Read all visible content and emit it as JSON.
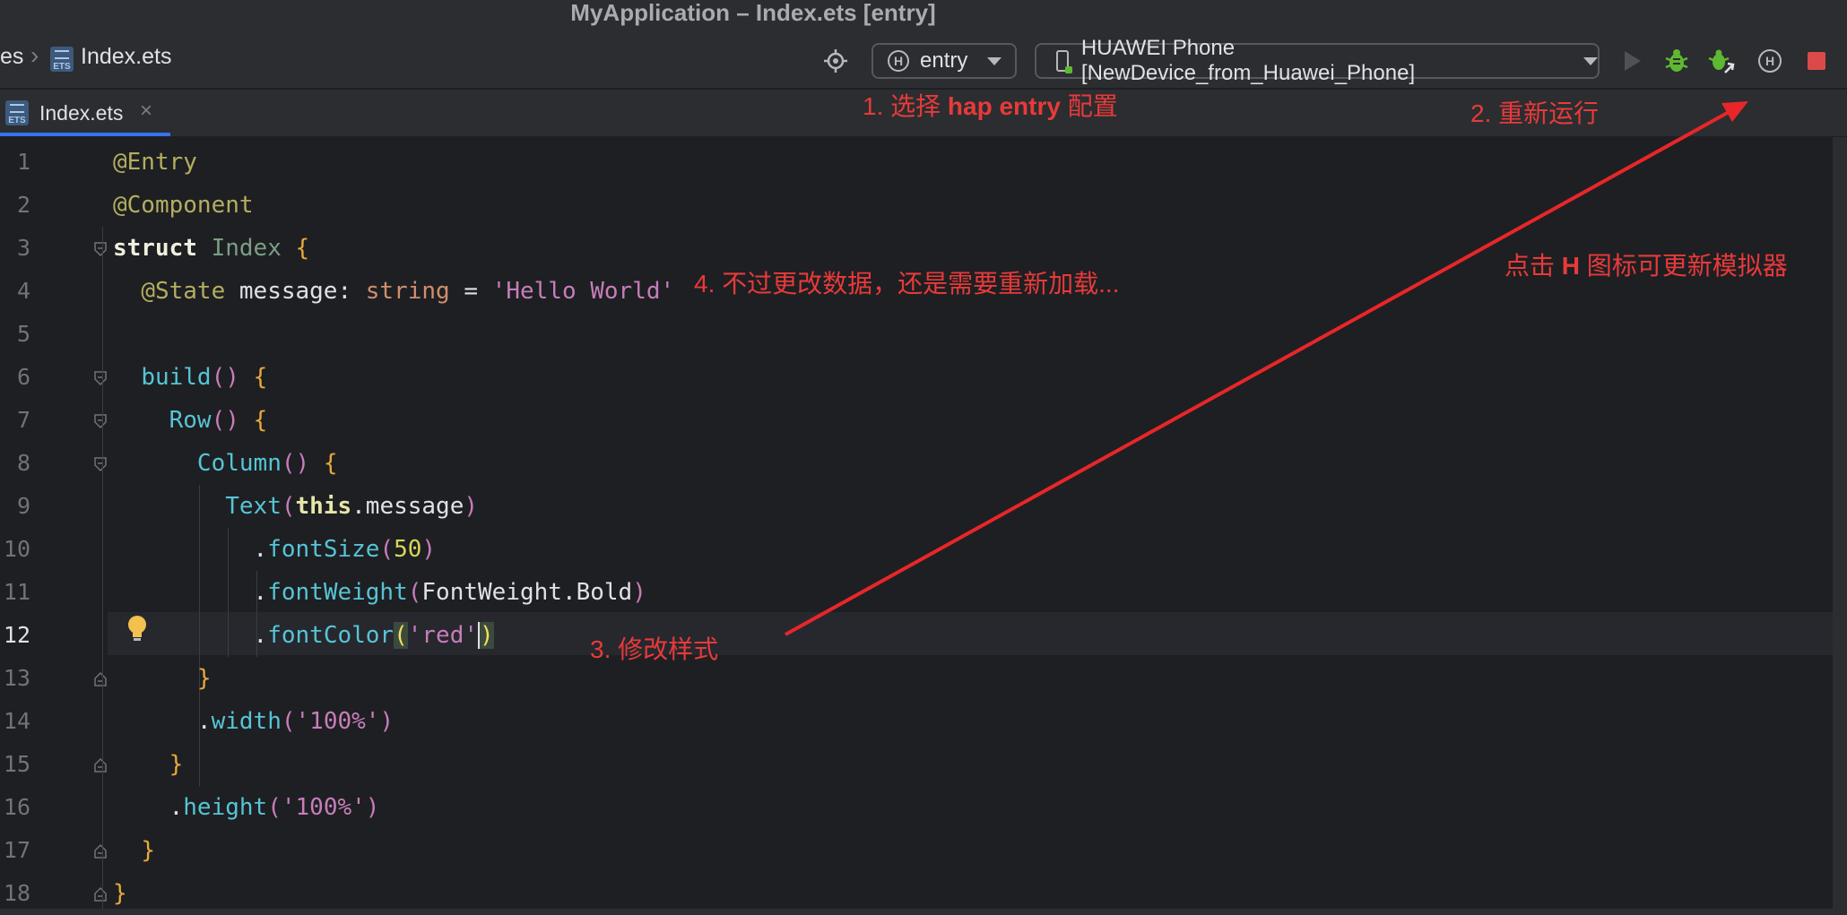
{
  "window": {
    "title": "MyApplication – Index.ets [entry]"
  },
  "breadcrumb": {
    "prev_fragment": "es",
    "file": "Index.ets"
  },
  "toolbar": {
    "module_config": "entry",
    "device": "HUAWEI Phone [NewDevice_from_Huawei_Phone]",
    "icons": [
      "target-icon",
      "harmony-h-icon",
      "run-icon",
      "debug-icon",
      "attach-debugger-icon",
      "harmony-h-icon",
      "stop-icon"
    ]
  },
  "tabs": [
    {
      "label": "Index.ets",
      "active": true
    }
  ],
  "editor": {
    "line_numbers": [
      "1",
      "2",
      "3",
      "4",
      "5",
      "6",
      "7",
      "8",
      "9",
      "10",
      "11",
      "12",
      "13",
      "14",
      "15",
      "16",
      "17",
      "18"
    ],
    "current_line": 12
  },
  "annotations": {
    "note1_prefix": "1. 选择 ",
    "note1_bold": "hap entry",
    "note1_suffix": " 配置",
    "note2": "2. 重新运行",
    "note3": "3.  修改样式",
    "note4": "4. 不过更改数据，还是需要重新加载...",
    "note_h_prefix": "点击 ",
    "note_h_bold": "H",
    "note_h_suffix": " 图标可更新模拟器"
  },
  "colors": {
    "annotation_red": "#e83a3a",
    "accent_blue": "#3574f0"
  }
}
